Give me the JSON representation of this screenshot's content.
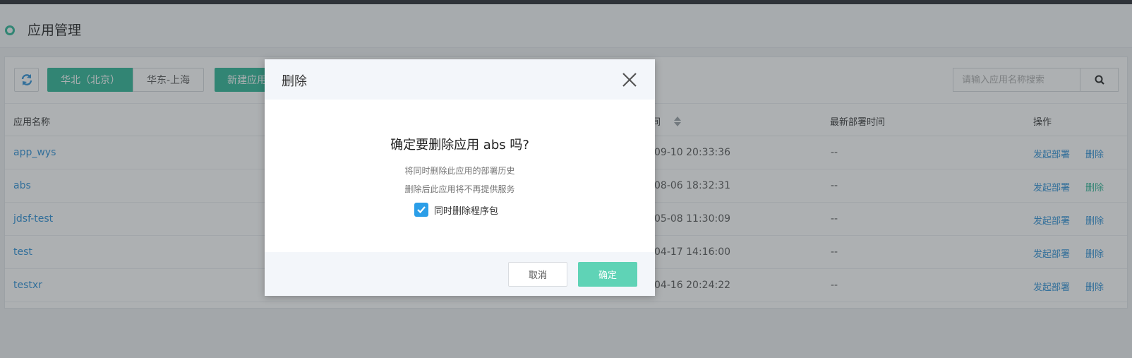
{
  "header": {
    "title": "应用管理"
  },
  "toolbar": {
    "regions": [
      "华北（北京）",
      "华东-上海"
    ],
    "new_label": "新建应用",
    "search_placeholder": "请输入应用名称搜索"
  },
  "table": {
    "columns": {
      "name": "应用名称",
      "time": "时间",
      "deploy": "最新部署时间",
      "ops": "操作"
    },
    "rows": [
      {
        "name": "app_wys",
        "time": "09-10 20:33:36",
        "deploy": "--",
        "op1": "发起部署",
        "op2": "删除"
      },
      {
        "name": "abs",
        "time": "08-06 18:32:31",
        "deploy": "--",
        "op1": "发起部署",
        "op2": "删除"
      },
      {
        "name": "jdsf-test",
        "time": "05-08 11:30:09",
        "deploy": "--",
        "op1": "发起部署",
        "op2": "删除"
      },
      {
        "name": "test",
        "time": "04-17 14:16:00",
        "deploy": "--",
        "op1": "发起部署",
        "op2": "删除"
      },
      {
        "name": "testxr",
        "time": "04-16 20:24:22",
        "deploy": "--",
        "op1": "发起部署",
        "op2": "删除"
      }
    ]
  },
  "modal": {
    "title": "删除",
    "question": "确定要删除应用 abs 吗?",
    "note1": "将同时删除此应用的部署历史",
    "note2": "删除后此应用将不再提供服务",
    "checkbox_label": "同时删除程序包",
    "checkbox_checked": true,
    "cancel_label": "取消",
    "confirm_label": "确定"
  },
  "colors": {
    "accent": "#2bb595",
    "link": "#2b8fd6",
    "checkbox": "#2b9ee8",
    "confirm": "#5fd3b6"
  }
}
